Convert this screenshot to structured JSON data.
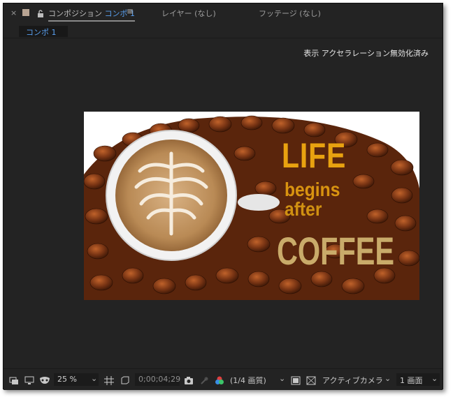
{
  "tabs": {
    "close_glyph": "×",
    "panel_label": "コンポジション",
    "comp_name": "コンポ 1",
    "menu_glyph": "≡",
    "layer_tab": "レイヤー (なし)",
    "footage_tab": "フッテージ (なし)",
    "swatch_color": "#b8a493"
  },
  "breadcrumb": {
    "label": "コンポ 1"
  },
  "viewer": {
    "accel_notice": "表示 アクセラレーション無効化済み",
    "composition_text": {
      "line1": "LIFE",
      "line2": "begins",
      "line3": "after",
      "line4": "COFFEE"
    }
  },
  "toolbar": {
    "zoom": "25 %",
    "timecode": "0;00;04;29",
    "resolution": "(1/4 画質)",
    "camera": "アクティブカメラ",
    "views": "1 画面",
    "accent_colors": [
      "#e04040",
      "#3a8ee6",
      "#3cc46a"
    ]
  }
}
